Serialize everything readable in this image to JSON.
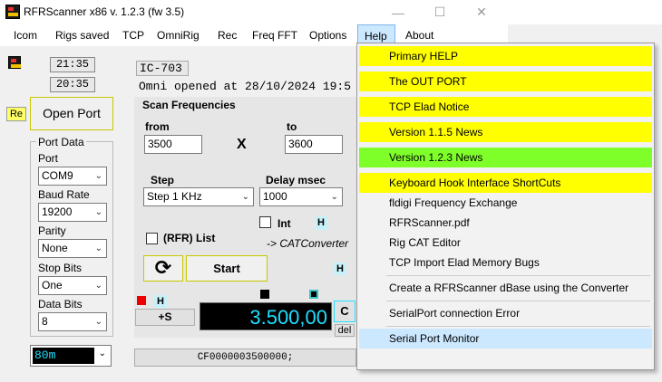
{
  "window": {
    "title": "RFRScanner  x86 v. 1.2.3  (fw 3.5)"
  },
  "menu": {
    "items": [
      "Icom",
      "Rigs saved",
      "TCP",
      "OmniRig",
      "Rec",
      "Freq FFT",
      "Options",
      "Help",
      "About"
    ]
  },
  "clock": {
    "time1": "21:35",
    "time2": "20:35"
  },
  "radio": {
    "model": "IC-703",
    "status": "Omni opened at 28/10/2024 19:5"
  },
  "left": {
    "re_label": "Re",
    "open_port": "Open Port",
    "port_data_title": "Port Data",
    "port_label": "Port",
    "port_value": "COM9",
    "baud_label": "Baud Rate",
    "baud_value": "19200",
    "parity_label": "Parity",
    "parity_value": "None",
    "stop_label": "Stop Bits",
    "stop_value": "One",
    "data_label": "Data Bits",
    "data_value": "8",
    "band_value": "80m"
  },
  "scan": {
    "title": "Scan Frequencies",
    "from_label": "from",
    "from_value": "3500",
    "x_label": "X",
    "to_label": "to",
    "to_value": "3600",
    "step_label": "Step",
    "step_value": "Step 1 KHz",
    "delay_label": "Delay  msec",
    "delay_value": "1000",
    "int_label": "Int",
    "h_label": "H",
    "rfr_label": "(RFR) List",
    "cat_label": "-> CATConverter",
    "start_label": "Start",
    "h2_label": "H",
    "h3_label": "H",
    "plus_s": "+S",
    "frequency": "3.500,00",
    "c_label": "C",
    "del_label": "del",
    "cat_string": "CF0000003500000;"
  },
  "help_menu": {
    "items": [
      "Primary HELP",
      "The OUT PORT",
      "TCP Elad Notice",
      "Version 1.1.5 News",
      "Version 1.2.3 News",
      "Keyboard Hook Interface ShortCuts",
      "fldigi Frequency Exchange",
      "RFRScanner.pdf",
      "Rig CAT Editor",
      "TCP Import Elad Memory Bugs",
      "Create a RFRScanner dBase using the Converter",
      "SerialPort connection Error",
      "Serial Port Monitor"
    ]
  },
  "colors": {
    "highlight_yellow": "#ffff00",
    "highlight_green": "#7fff2a",
    "freq_display_bg": "#000000",
    "freq_display_fg": "#1ee0ff"
  }
}
